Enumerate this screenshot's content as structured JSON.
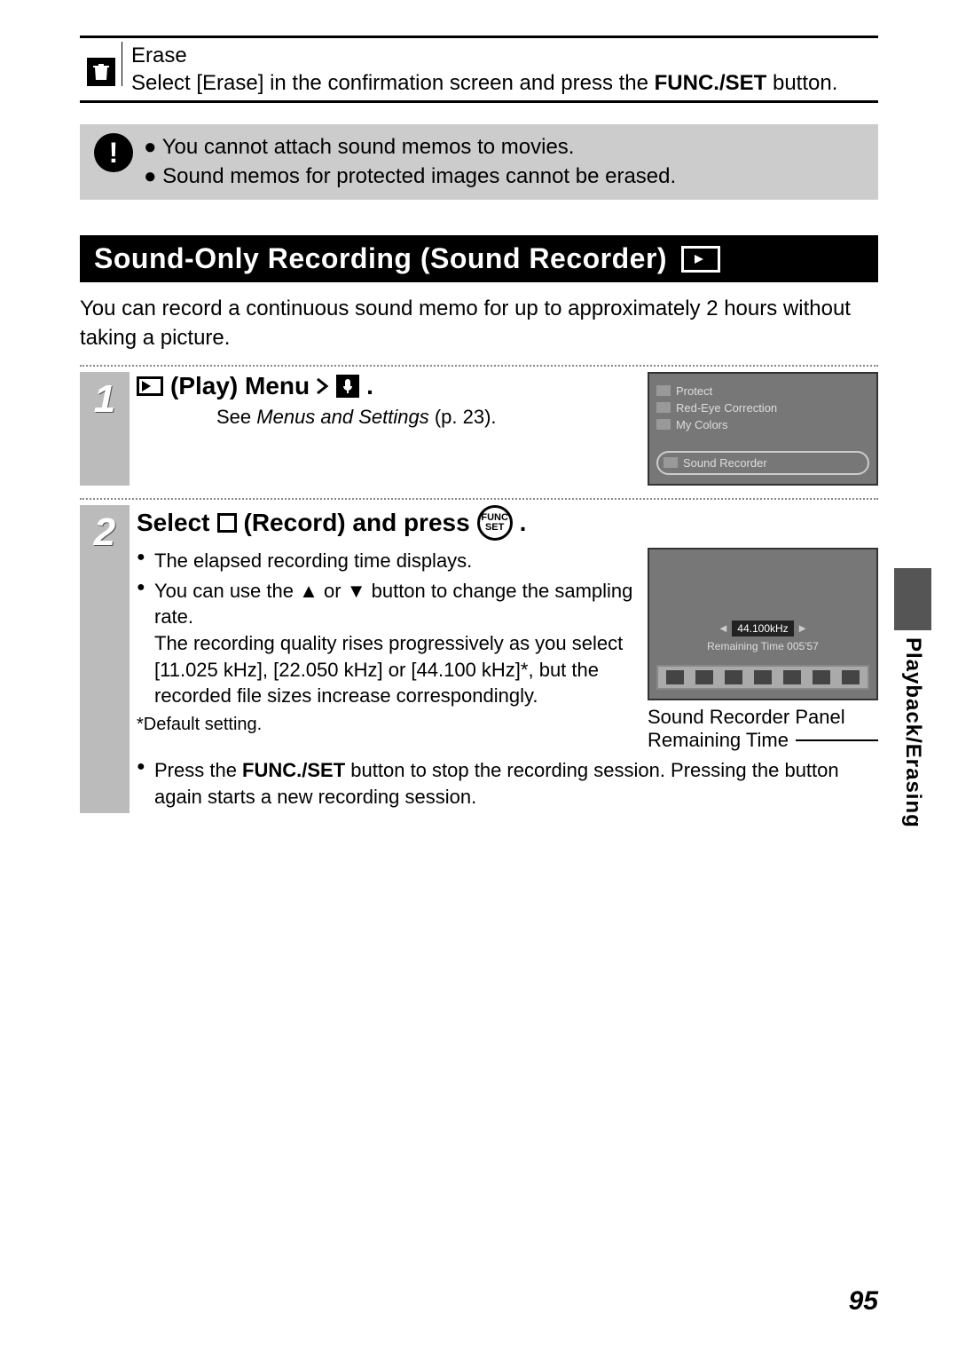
{
  "erase": {
    "title": "Erase",
    "body_pre": "Select [Erase] in the confirmation screen and press the ",
    "body_strong": "FUNC./SET",
    "body_post": " button."
  },
  "caution": {
    "items": [
      "You cannot attach sound memos to movies.",
      "Sound memos for protected images cannot be erased."
    ]
  },
  "heading": "Sound-Only Recording (Sound Recorder)",
  "intro": "You can record a continuous sound memo for up to approximately 2 hours without taking a picture.",
  "step1": {
    "num": "1",
    "title_a": "(Play) Menu",
    "sub_pre": "See ",
    "sub_ital": "Menus and Settings",
    "sub_post": " (p. 23).",
    "lcd": {
      "item1": "Protect",
      "item2": "Red-Eye Correction",
      "item3": "My Colors",
      "item_hl": "Sound Recorder"
    }
  },
  "step2": {
    "num": "2",
    "title_a": "Select",
    "title_b": "(Record) and press",
    "bullet1": "The elapsed recording time displays.",
    "bullet2_a": "You can use the ",
    "bullet2_b": " or ",
    "bullet2_c": " button to change the sampling rate.",
    "bullet2_d": "The recording quality rises progressively as you select [11.025 kHz], [22.050 kHz] or [44.100 kHz]*, but the recorded file sizes increase correspondingly.",
    "footnote": "*Default setting.",
    "bullet3_a": "Press the ",
    "bullet3_b": "FUNC./SET",
    "bullet3_c": " button to stop the recording session. Pressing the button again starts a new recording session.",
    "lcd": {
      "rate": "44.100kHz",
      "remaining": "Remaining Time 005'57"
    },
    "caption1": "Sound Recorder Panel",
    "caption2": "Remaining Time"
  },
  "funcset_label": "FUNC SET",
  "side_tab": "Playback/Erasing",
  "page_number": "95"
}
